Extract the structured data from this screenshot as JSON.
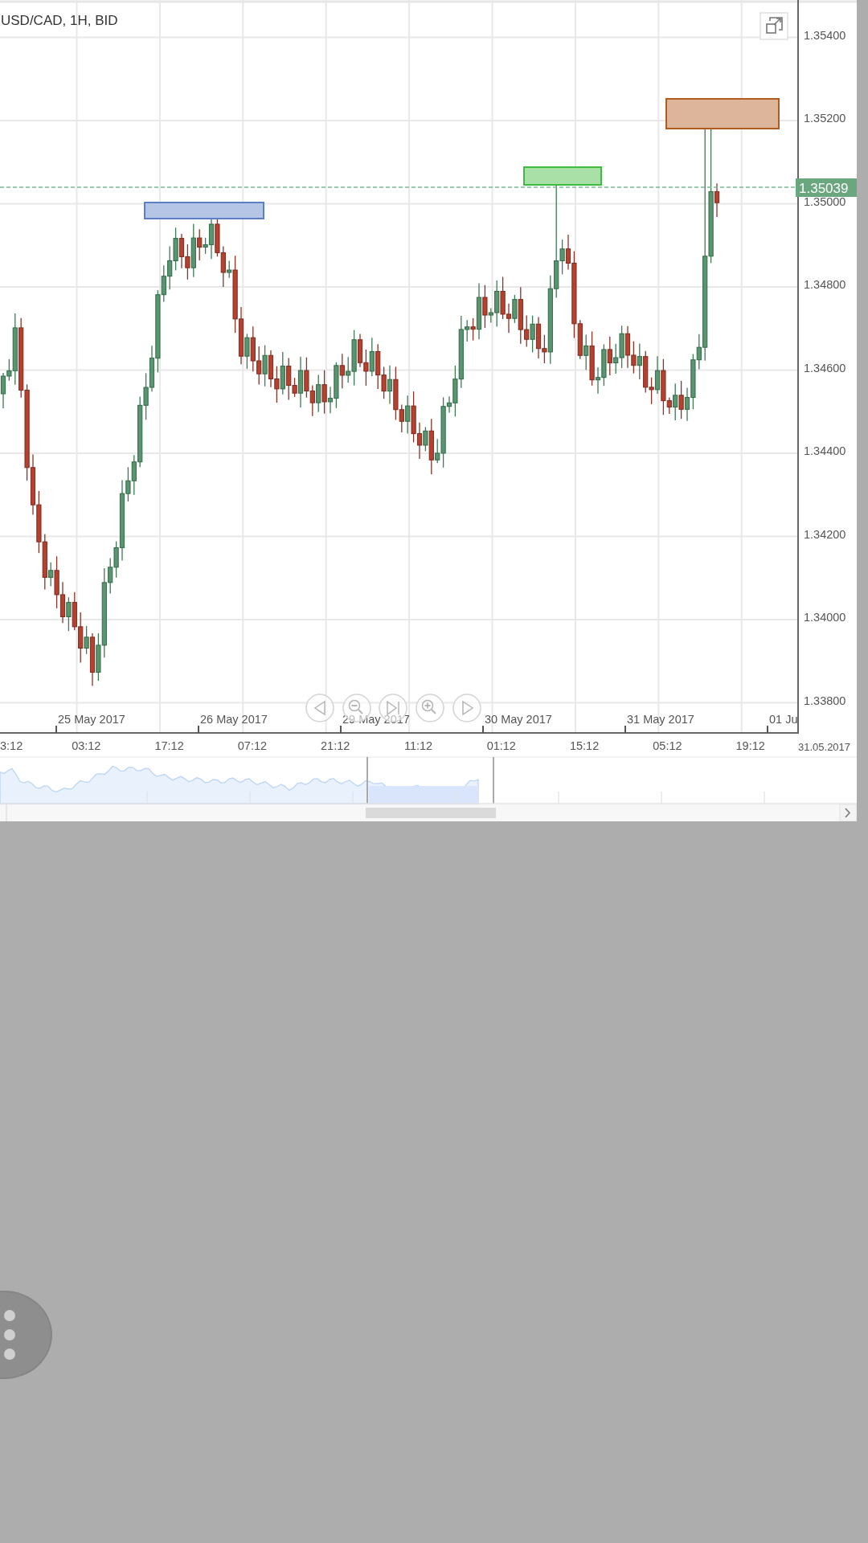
{
  "chart": {
    "title": "USD/CAD, 1H, BID",
    "price_tag": "1.35039",
    "y_axis_labels": [
      "1.35400",
      "1.35200",
      "1.35000",
      "1.34800",
      "1.34600",
      "1.34400",
      "1.34200",
      "1.34000",
      "1.33800"
    ],
    "date_labels": [
      "25 May 2017",
      "26 May 2017",
      "29 May 2017",
      "30 May 2017",
      "31 May 2017",
      "01 Ju"
    ],
    "time_labels": [
      "3:12",
      "03:12",
      "17:12",
      "07:12",
      "21:12",
      "11:12",
      "01:12",
      "15:12",
      "05:12",
      "19:12"
    ],
    "date_stamp": "31.05.2017",
    "zones": [
      {
        "color": "#5b7fc7"
      },
      {
        "color": "#3dbb3d"
      },
      {
        "color": "#b25b1f"
      }
    ]
  }
}
